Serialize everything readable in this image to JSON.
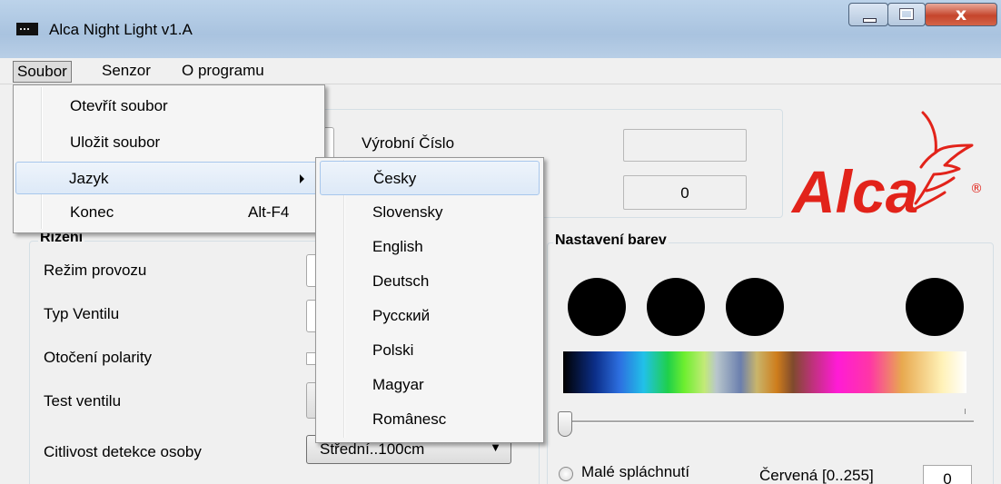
{
  "window": {
    "title": "Alca Night Light  v1.A",
    "close_glyph": "x"
  },
  "menubar": {
    "items": [
      "Soubor",
      "Senzor",
      "O programu"
    ]
  },
  "soubor_menu": {
    "items": [
      {
        "label": "Otevřít soubor",
        "shortcut": ""
      },
      {
        "label": "Uložit soubor",
        "shortcut": ""
      },
      {
        "label": "Jazyk",
        "shortcut": "",
        "submenu": true
      },
      {
        "label": "Konec",
        "shortcut": "Alt-F4"
      }
    ]
  },
  "language_menu": {
    "items": [
      "Česky",
      "Slovensky",
      "English",
      "Deutsch",
      "Русский",
      "Polski",
      "Magyar",
      "Românesc"
    ],
    "highlighted": "Česky"
  },
  "device": {
    "serial_label": "Výrobní Číslo",
    "serial_value": "",
    "count_value": "0"
  },
  "control": {
    "group_title": "Řízení",
    "labels": [
      "Režim provozu",
      "Typ Ventilu",
      "Otočení polarity",
      "Test ventilu",
      "Citlivost detekce osoby"
    ],
    "sensitivity_value": "Střední..100cm"
  },
  "colors": {
    "group_title": "Nastavení barev",
    "small_flush_label": "Malé spláchnutí",
    "red_label": "Červená [0..255]",
    "red_value": "0",
    "dot_color": "#000000"
  },
  "logo": {
    "text": "Alca",
    "mark": "®",
    "color": "#e2231a"
  },
  "colors_theme": {
    "menu_highlight": "#dde9f7",
    "window_bg": "#f0f0f0"
  }
}
